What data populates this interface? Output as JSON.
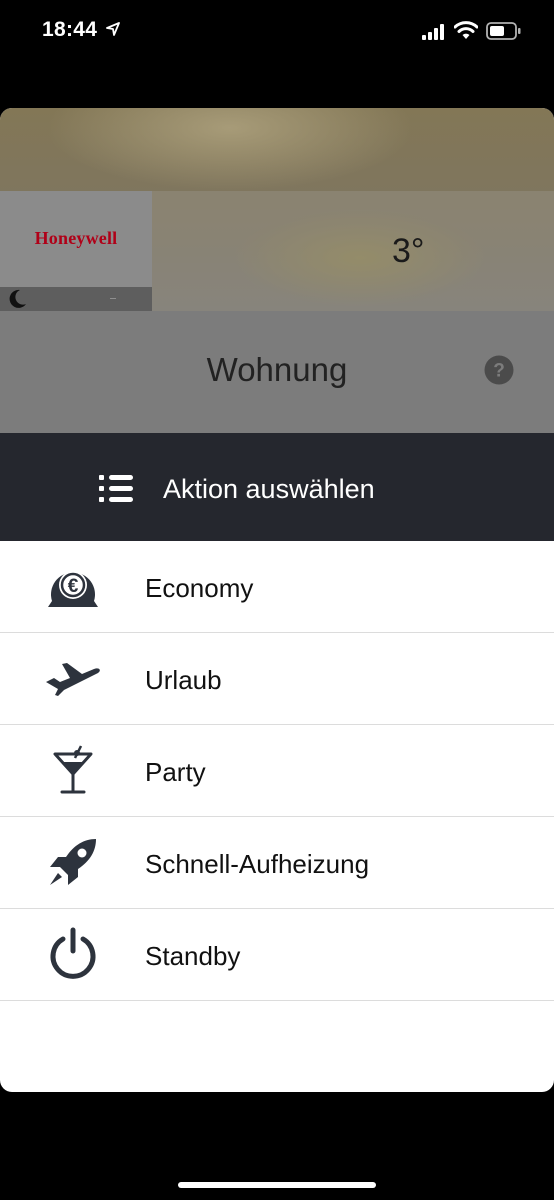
{
  "status_bar": {
    "time": "18:44",
    "icons": [
      "location-arrow-icon",
      "signal-bars-icon",
      "wifi-icon",
      "battery-icon"
    ]
  },
  "header": {
    "brand": "Honeywell",
    "brand_color": "#b00018",
    "temperature": "3°",
    "room_name": "Wohnung",
    "mode_icon": "moon-icon",
    "help_icon": "help-icon"
  },
  "action_bar": {
    "icon": "list-icon",
    "title": "Aktion auswählen",
    "background": "#25272e"
  },
  "menu": {
    "items": [
      {
        "label": "Economy",
        "icon": "euro-gauge-icon"
      },
      {
        "label": "Urlaub",
        "icon": "airplane-icon"
      },
      {
        "label": "Party",
        "icon": "cocktail-icon"
      },
      {
        "label": "Schnell-Aufheizung",
        "icon": "rocket-icon"
      },
      {
        "label": "Standby",
        "icon": "power-icon"
      }
    ]
  }
}
